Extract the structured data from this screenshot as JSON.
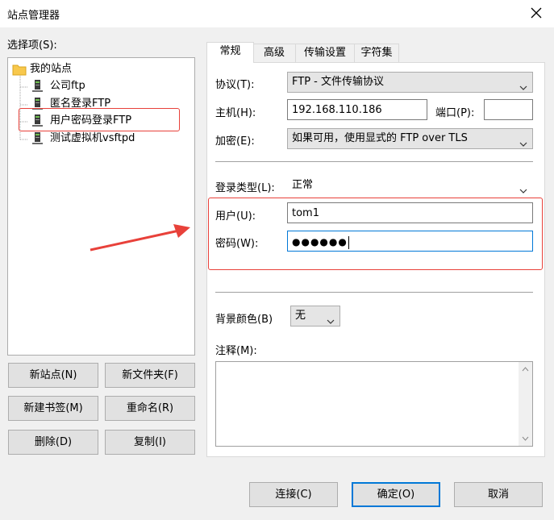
{
  "window": {
    "title": "站点管理器"
  },
  "tree": {
    "label": "选择项(S):",
    "root": "我的站点",
    "items": [
      "公司ftp",
      "匿名登录FTP",
      "用户密码登录FTP",
      "测试虚拟机vsftpd"
    ]
  },
  "left_buttons": [
    "新站点(N)",
    "新文件夹(F)",
    "新建书签(M)",
    "重命名(R)",
    "删除(D)",
    "复制(I)"
  ],
  "tabs": [
    "常规",
    "高级",
    "传输设置",
    "字符集"
  ],
  "general": {
    "protocol_label": "协议(T):",
    "protocol_value": "FTP - 文件传输协议",
    "host_label": "主机(H):",
    "host_value": "192.168.110.186",
    "port_label": "端口(P):",
    "port_value": "",
    "encryption_label": "加密(E):",
    "encryption_value": "如果可用，使用显式的 FTP over TLS",
    "logon_label": "登录类型(L):",
    "logon_value": "正常",
    "user_label": "用户(U):",
    "user_value": "tom1",
    "password_label": "密码(W):",
    "password_value": "●●●●●●",
    "bg_color_label": "背景颜色(B)",
    "bg_color_value": "无",
    "comments_label": "注释(M):",
    "comments_value": ""
  },
  "bottom_buttons": [
    "连接(C)",
    "确定(O)",
    "取消"
  ],
  "colors": {
    "annotation_red": "#e8413a",
    "folder": "#f8c84c",
    "focus_blue": "#0078d7"
  }
}
